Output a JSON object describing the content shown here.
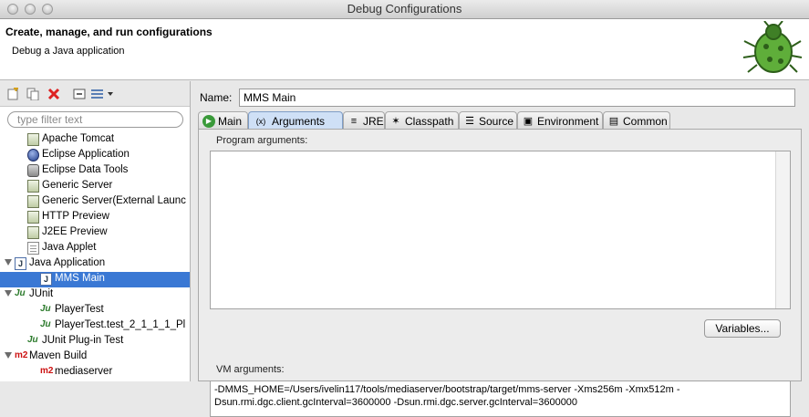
{
  "window": {
    "title": "Debug Configurations"
  },
  "header": {
    "title": "Create, manage, and run configurations",
    "subtitle": "Debug a Java application"
  },
  "left": {
    "toolbar": [
      "new-config-icon",
      "duplicate-icon",
      "delete-icon",
      "collapse-all-icon",
      "filter-icon"
    ],
    "filter_placeholder": "type filter text",
    "tree": [
      {
        "label": "Apache Tomcat",
        "icon": "server-icon",
        "depth": 1
      },
      {
        "label": "Eclipse Application",
        "icon": "eclipse-icon",
        "depth": 1
      },
      {
        "label": "Eclipse Data Tools",
        "icon": "database-icon",
        "depth": 1
      },
      {
        "label": "Generic Server",
        "icon": "server-icon",
        "depth": 1
      },
      {
        "label": "Generic Server(External Launc",
        "icon": "server-icon",
        "depth": 1
      },
      {
        "label": "HTTP Preview",
        "icon": "server-icon",
        "depth": 1
      },
      {
        "label": "J2EE Preview",
        "icon": "server-icon",
        "depth": 1
      },
      {
        "label": "Java Applet",
        "icon": "applet-icon",
        "depth": 1
      },
      {
        "label": "Java Application",
        "icon": "java-app-icon",
        "depth": 0,
        "expanded": true
      },
      {
        "label": "MMS Main",
        "icon": "java-app-icon",
        "depth": 2,
        "selected": true
      },
      {
        "label": "JUnit",
        "icon": "junit-icon",
        "depth": 0,
        "expanded": true
      },
      {
        "label": "PlayerTest",
        "icon": "junit-icon",
        "depth": 2
      },
      {
        "label": "PlayerTest.test_2_1_1_1_Pl",
        "icon": "junit-icon",
        "depth": 2
      },
      {
        "label": "JUnit Plug-in Test",
        "icon": "junit-plugin-icon",
        "depth": 1
      },
      {
        "label": "Maven Build",
        "icon": "maven-icon",
        "depth": 0,
        "expanded": true
      },
      {
        "label": "mediaserver",
        "icon": "maven-icon",
        "depth": 2
      }
    ]
  },
  "right": {
    "name_label": "Name:",
    "name_value": "MMS Main",
    "tabs": [
      {
        "label": "Main",
        "icon": "main-tab-icon"
      },
      {
        "label": "Arguments",
        "icon": "arguments-tab-icon",
        "active": true
      },
      {
        "label": "JRE",
        "icon": "jre-tab-icon"
      },
      {
        "label": "Classpath",
        "icon": "classpath-tab-icon"
      },
      {
        "label": "Source",
        "icon": "source-tab-icon"
      },
      {
        "label": "Environment",
        "icon": "environment-tab-icon"
      },
      {
        "label": "Common",
        "icon": "common-tab-icon"
      }
    ],
    "program_args_label": "Program arguments:",
    "program_args_value": "",
    "variables_button": "Variables...",
    "vm_args_label": "VM arguments:",
    "vm_args_value": "-DMMS_HOME=/Users/ivelin117/tools/mediaserver/bootstrap/target/mms-server -Xms256m -Xmx512m -Dsun.rmi.dgc.client.gcInterval=3600000 -Dsun.rmi.dgc.server.gcInterval=3600000"
  }
}
